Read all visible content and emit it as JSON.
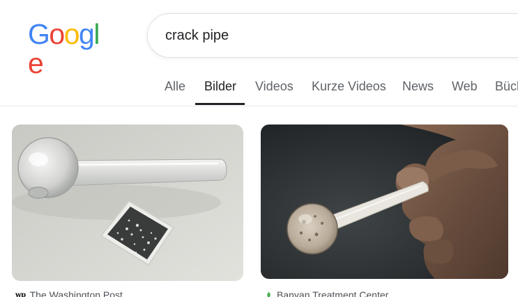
{
  "logo": {
    "letters": [
      "G",
      "o",
      "o",
      "g",
      "l",
      "e"
    ]
  },
  "search": {
    "query": "crack pipe"
  },
  "tabs": [
    {
      "label": "Alle"
    },
    {
      "label": "Bilder"
    },
    {
      "label": "Videos"
    },
    {
      "label": "Kurze Videos"
    },
    {
      "label": "News"
    },
    {
      "label": "Web"
    },
    {
      "label": "Büch"
    }
  ],
  "active_tab": "Bilder",
  "results": [
    {
      "source": "The Washington Post",
      "favicon": "wp",
      "favicon_icon": "washington-post-favicon"
    },
    {
      "source": "Banyan Treatment Center",
      "favicon": "leaf",
      "favicon_icon": "banyan-leaf-favicon"
    }
  ],
  "colors": {
    "blue": "#4285F4",
    "red": "#EA4335",
    "yellow": "#FBBC05",
    "green": "#34A853",
    "tab_active": "#202124",
    "tab_inactive": "#5f6368"
  }
}
